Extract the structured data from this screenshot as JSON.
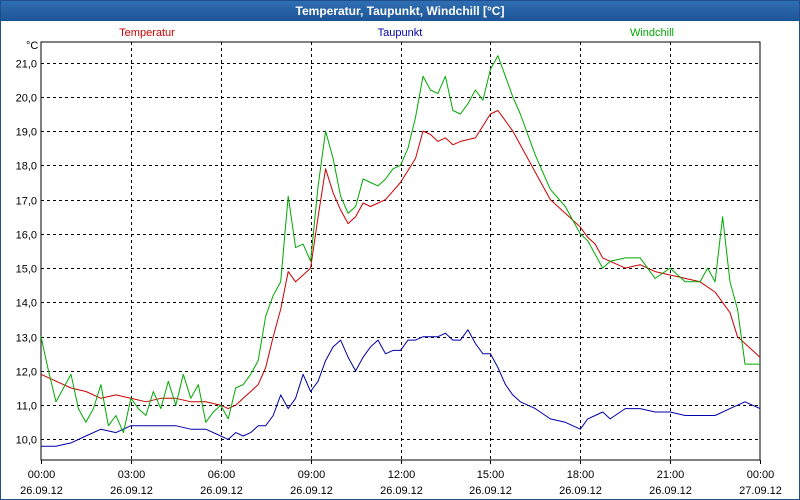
{
  "window": {
    "title": "Temperatur, Taupunkt, Windchill [°C]"
  },
  "chart_data": {
    "type": "line",
    "title": "Temperatur, Taupunkt, Windchill [°C]",
    "ylabel": "°C",
    "ylim": [
      9.4,
      21.6
    ],
    "yticks": [
      "10,0",
      "11,0",
      "12,0",
      "13,0",
      "14,0",
      "15,0",
      "16,0",
      "17,0",
      "18,0",
      "19,0",
      "20,0",
      "21,0"
    ],
    "ytick_values": [
      10,
      11,
      12,
      13,
      14,
      15,
      16,
      17,
      18,
      19,
      20,
      21
    ],
    "xlim": [
      0,
      24
    ],
    "xticks": [
      {
        "time": "00:00",
        "date": "26.09.12"
      },
      {
        "time": "03:00",
        "date": "26.09.12"
      },
      {
        "time": "06:00",
        "date": "26.09.12"
      },
      {
        "time": "09:00",
        "date": "26.09.12"
      },
      {
        "time": "12:00",
        "date": "26.09.12"
      },
      {
        "time": "15:00",
        "date": "26.09.12"
      },
      {
        "time": "18:00",
        "date": "26.09.12"
      },
      {
        "time": "21:00",
        "date": "26.09.12"
      },
      {
        "time": "00:00",
        "date": "27.09.12"
      }
    ],
    "grid": true,
    "legend_position": "top",
    "series": [
      {
        "name": "Temperatur",
        "color": "#cc0000",
        "x": [
          0,
          0.5,
          1,
          1.5,
          2,
          2.5,
          3,
          3.5,
          4,
          4.5,
          5,
          5.5,
          6,
          6.25,
          6.5,
          6.75,
          7,
          7.25,
          7.5,
          7.75,
          8,
          8.25,
          8.5,
          8.75,
          9,
          9.25,
          9.5,
          9.75,
          10,
          10.25,
          10.5,
          10.75,
          11,
          11.5,
          12,
          12.5,
          12.75,
          13,
          13.25,
          13.5,
          13.75,
          14,
          14.5,
          15,
          15.25,
          15.5,
          15.75,
          16,
          16.5,
          17,
          17.5,
          18,
          18.25,
          18.5,
          18.75,
          19,
          19.25,
          19.5,
          20,
          20.5,
          21,
          21.5,
          22,
          22.5,
          23,
          23.25,
          23.5,
          23.75,
          24
        ],
        "values": [
          11.9,
          11.7,
          11.5,
          11.4,
          11.2,
          11.3,
          11.2,
          11.1,
          11.2,
          11.2,
          11.1,
          11.1,
          11.0,
          10.9,
          11.0,
          11.2,
          11.4,
          11.6,
          12.1,
          13.0,
          13.8,
          14.9,
          14.6,
          14.8,
          15.0,
          16.5,
          17.9,
          17.2,
          16.7,
          16.3,
          16.5,
          16.9,
          16.8,
          17.0,
          17.5,
          18.2,
          19.0,
          18.9,
          18.7,
          18.8,
          18.6,
          18.7,
          18.8,
          19.5,
          19.6,
          19.3,
          19.0,
          18.6,
          17.8,
          17.0,
          16.6,
          16.2,
          15.9,
          15.7,
          15.3,
          15.2,
          15.1,
          15.0,
          15.1,
          14.9,
          14.8,
          14.7,
          14.6,
          14.3,
          13.7,
          13.0,
          12.8,
          12.6,
          12.4
        ]
      },
      {
        "name": "Taupunkt",
        "color": "#0000aa",
        "x": [
          0,
          0.5,
          1,
          1.5,
          2,
          2.5,
          3,
          3.5,
          4,
          4.5,
          5,
          5.5,
          6,
          6.25,
          6.5,
          6.75,
          7,
          7.25,
          7.5,
          7.75,
          8,
          8.25,
          8.5,
          8.75,
          9,
          9.25,
          9.5,
          9.75,
          10,
          10.25,
          10.5,
          10.75,
          11,
          11.25,
          11.5,
          11.75,
          12,
          12.25,
          12.5,
          12.75,
          13,
          13.25,
          13.5,
          13.75,
          14,
          14.25,
          14.5,
          14.75,
          15,
          15.25,
          15.5,
          15.75,
          16,
          16.5,
          17,
          17.5,
          18,
          18.25,
          18.5,
          18.75,
          19,
          19.5,
          20,
          20.5,
          21,
          21.5,
          22,
          22.5,
          23,
          23.5,
          24
        ],
        "values": [
          9.8,
          9.8,
          9.9,
          10.1,
          10.3,
          10.2,
          10.4,
          10.4,
          10.4,
          10.4,
          10.3,
          10.3,
          10.1,
          10.0,
          10.2,
          10.1,
          10.2,
          10.4,
          10.4,
          10.7,
          11.3,
          10.9,
          11.2,
          11.9,
          11.4,
          11.7,
          12.3,
          12.7,
          12.9,
          12.4,
          12.0,
          12.4,
          12.7,
          12.9,
          12.5,
          12.6,
          12.6,
          12.9,
          12.9,
          13.0,
          13.0,
          13.0,
          13.1,
          12.9,
          12.9,
          13.2,
          12.8,
          12.5,
          12.5,
          12.1,
          11.6,
          11.3,
          11.1,
          10.9,
          10.6,
          10.5,
          10.3,
          10.6,
          10.7,
          10.8,
          10.6,
          10.9,
          10.9,
          10.8,
          10.8,
          10.7,
          10.7,
          10.7,
          10.9,
          11.1,
          10.9
        ]
      },
      {
        "name": "Windchill",
        "color": "#00aa00",
        "x": [
          0,
          0.25,
          0.5,
          0.75,
          1,
          1.25,
          1.5,
          1.75,
          2,
          2.25,
          2.5,
          2.75,
          3,
          3.25,
          3.5,
          3.75,
          4,
          4.25,
          4.5,
          4.75,
          5,
          5.25,
          5.5,
          5.75,
          6,
          6.25,
          6.5,
          6.75,
          7,
          7.25,
          7.5,
          7.75,
          8,
          8.25,
          8.5,
          8.75,
          9,
          9.25,
          9.5,
          9.75,
          10,
          10.25,
          10.5,
          10.75,
          11,
          11.25,
          11.5,
          11.75,
          12,
          12.25,
          12.5,
          12.75,
          13,
          13.25,
          13.5,
          13.75,
          14,
          14.25,
          14.5,
          14.75,
          15,
          15.25,
          15.5,
          15.75,
          16,
          16.5,
          17,
          17.5,
          18,
          18.25,
          18.5,
          18.75,
          19,
          19.5,
          20,
          20.5,
          21,
          21.5,
          22,
          22.25,
          22.5,
          22.75,
          23,
          23.25,
          23.5,
          23.75,
          24
        ],
        "values": [
          13.0,
          12.0,
          11.1,
          11.5,
          11.9,
          10.9,
          10.5,
          10.9,
          11.6,
          10.4,
          10.7,
          10.2,
          11.2,
          10.9,
          10.7,
          11.4,
          10.9,
          11.7,
          11.0,
          11.9,
          11.2,
          11.6,
          10.5,
          10.8,
          11.0,
          10.6,
          11.5,
          11.6,
          11.9,
          12.3,
          13.6,
          14.2,
          14.6,
          17.1,
          15.6,
          15.7,
          15.2,
          17.4,
          19.0,
          18.2,
          17.1,
          16.6,
          16.8,
          17.6,
          17.5,
          17.4,
          17.6,
          17.9,
          18.0,
          18.5,
          19.4,
          20.6,
          20.2,
          20.1,
          20.6,
          19.6,
          19.5,
          19.8,
          20.2,
          19.9,
          20.8,
          21.2,
          20.6,
          20.0,
          19.5,
          18.3,
          17.3,
          16.8,
          16.0,
          15.8,
          15.4,
          15.0,
          15.2,
          15.3,
          15.3,
          14.7,
          15.0,
          14.6,
          14.6,
          15.0,
          14.6,
          16.5,
          14.6,
          13.8,
          12.2,
          12.2,
          12.2
        ]
      }
    ]
  }
}
